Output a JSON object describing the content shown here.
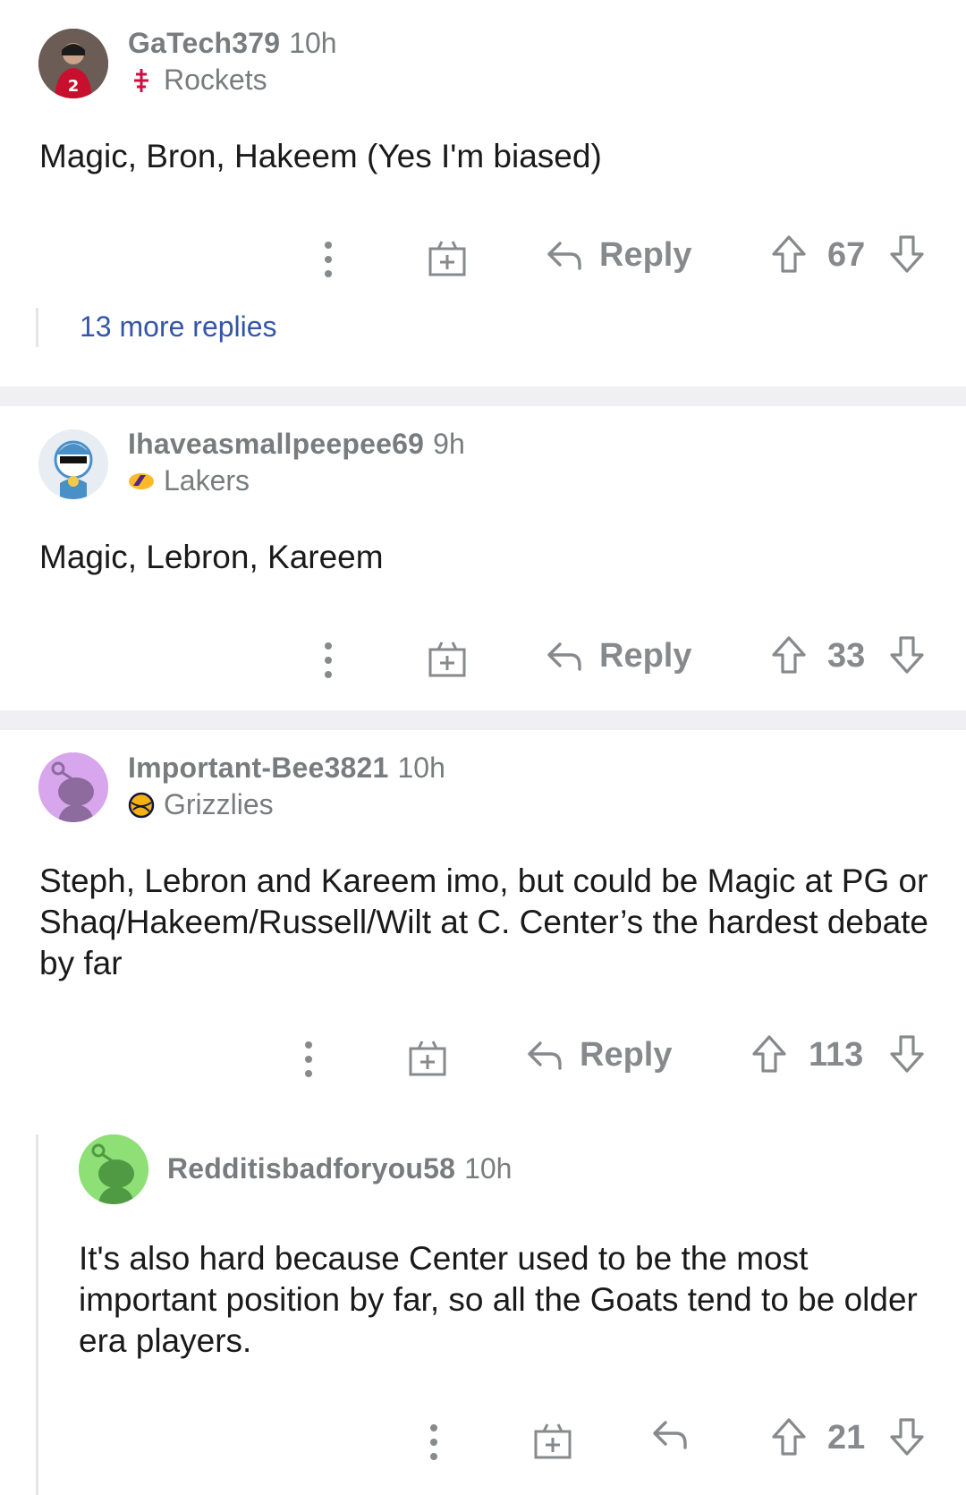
{
  "colors": {
    "meta_gray": "#787c7e",
    "action_gray": "#878a8c",
    "link_blue": "#3456a8",
    "divider": "#f0f0f2"
  },
  "comments": [
    {
      "username": "GaTech379",
      "time": "10h",
      "flair_icon": "rockets-icon",
      "flair": "Rockets",
      "body": "Magic, Bron, Hakeem (Yes I'm biased)",
      "reply_label": "Reply",
      "votes": "67",
      "more_replies": "13 more replies"
    },
    {
      "username": "Ihaveasmallpeepee69",
      "time": "9h",
      "flair_icon": "lakers-icon",
      "flair": "Lakers",
      "body": "Magic, Lebron, Kareem",
      "reply_label": "Reply",
      "votes": "33"
    },
    {
      "username": "Important-Bee3821",
      "time": "10h",
      "flair_icon": "grizzlies-icon",
      "flair": "Grizzlies",
      "body": "Steph, Lebron and Kareem imo, but could be Magic at PG or Shaq/Hakeem/Russell/Wilt at C. Center’s the hardest debate by far",
      "reply_label": "Reply",
      "votes": "113"
    },
    {
      "username": "Redditisbadforyou58",
      "time": "10h",
      "body": "It's also hard because Center used to be the most important position by far, so all the Goats tend to be older era players.",
      "votes": "21"
    }
  ]
}
